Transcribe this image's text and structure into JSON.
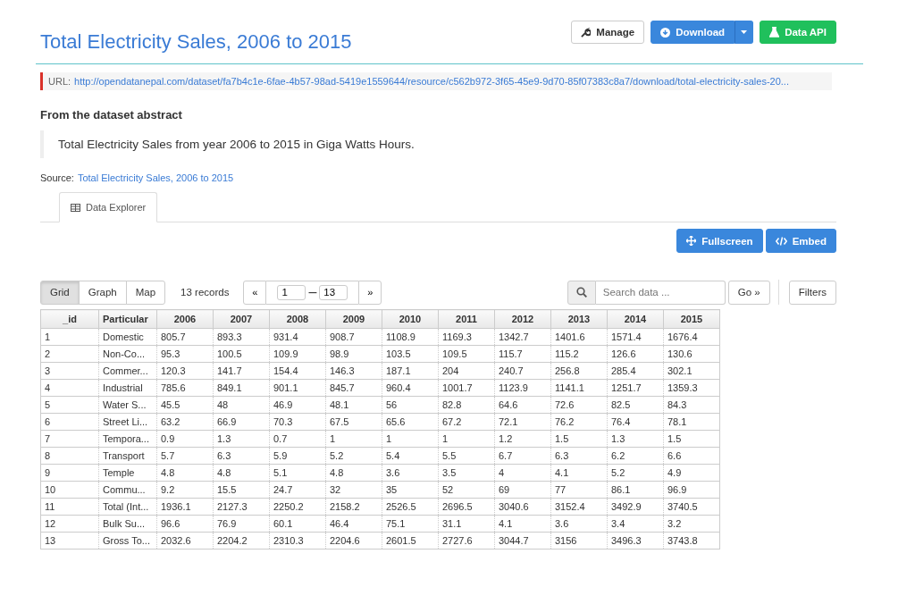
{
  "title": "Total Electricity Sales, 2006 to 2015",
  "actions": [
    {
      "kind": "manage",
      "label": "Manage"
    },
    {
      "kind": "download",
      "label": "Download"
    },
    {
      "kind": "api",
      "label": "Data API"
    }
  ],
  "url": {
    "label": "URL:",
    "link": "http://opendatanepal.com/dataset/fa7b4c1e-6fae-4b57-98ad-5419e1559644/resource/c562b972-3f65-45e9-9d70-85f07383c8a7/download/total-electricity-sales-20..."
  },
  "abstract": {
    "heading": "From the dataset abstract",
    "text": "Total Electricity Sales from year 2006 to 2015 in Giga Watts Hours."
  },
  "source": {
    "label": "Source:",
    "link": "Total Electricity Sales, 2006 to 2015"
  },
  "tabs": [
    {
      "label": "Data Explorer",
      "selected": true
    }
  ],
  "view_actions": [
    {
      "kind": "fullscreen",
      "label": "Fullscreen"
    },
    {
      "kind": "embed",
      "label": "Embed"
    }
  ],
  "views": [
    {
      "label": "Grid",
      "selected": true
    },
    {
      "label": "Graph",
      "selected": false
    },
    {
      "label": "Map",
      "selected": false
    }
  ],
  "records": "13 records",
  "pager": {
    "prev": "«",
    "from": "1",
    "dash": "–",
    "to": "13",
    "next": "»"
  },
  "search": {
    "placeholder": "Search data ...",
    "go": "Go »",
    "filters": "Filters"
  },
  "table": {
    "columns": [
      "_id",
      "Particular",
      "2006",
      "2007",
      "2008",
      "2009",
      "2010",
      "2011",
      "2012",
      "2013",
      "2014",
      "2015"
    ],
    "rows": [
      [
        "1",
        "Domestic",
        "805.7",
        "893.3",
        "931.4",
        "908.7",
        "1108.9",
        "1169.3",
        "1342.7",
        "1401.6",
        "1571.4",
        "1676.4"
      ],
      [
        "2",
        "Non-Co...",
        "95.3",
        "100.5",
        "109.9",
        "98.9",
        "103.5",
        "109.5",
        "115.7",
        "115.2",
        "126.6",
        "130.6"
      ],
      [
        "3",
        "Commer...",
        "120.3",
        "141.7",
        "154.4",
        "146.3",
        "187.1",
        "204",
        "240.7",
        "256.8",
        "285.4",
        "302.1"
      ],
      [
        "4",
        "Industrial",
        "785.6",
        "849.1",
        "901.1",
        "845.7",
        "960.4",
        "1001.7",
        "1123.9",
        "1141.1",
        "1251.7",
        "1359.3"
      ],
      [
        "5",
        "Water S...",
        "45.5",
        "48",
        "46.9",
        "48.1",
        "56",
        "82.8",
        "64.6",
        "72.6",
        "82.5",
        "84.3"
      ],
      [
        "6",
        "Street Li...",
        "63.2",
        "66.9",
        "70.3",
        "67.5",
        "65.6",
        "67.2",
        "72.1",
        "76.2",
        "76.4",
        "78.1"
      ],
      [
        "7",
        "Tempora...",
        "0.9",
        "1.3",
        "0.7",
        "1",
        "1",
        "1",
        "1.2",
        "1.5",
        "1.3",
        "1.5"
      ],
      [
        "8",
        "Transport",
        "5.7",
        "6.3",
        "5.9",
        "5.2",
        "5.4",
        "5.5",
        "6.7",
        "6.3",
        "6.2",
        "6.6"
      ],
      [
        "9",
        "Temple",
        "4.8",
        "4.8",
        "5.1",
        "4.8",
        "3.6",
        "3.5",
        "4",
        "4.1",
        "5.2",
        "4.9"
      ],
      [
        "10",
        "Commu...",
        "9.2",
        "15.5",
        "24.7",
        "32",
        "35",
        "52",
        "69",
        "77",
        "86.1",
        "96.9"
      ],
      [
        "11",
        "Total (Int...",
        "1936.1",
        "2127.3",
        "2250.2",
        "2158.2",
        "2526.5",
        "2696.5",
        "3040.6",
        "3152.4",
        "3492.9",
        "3740.5"
      ],
      [
        "12",
        "Bulk Su...",
        "96.6",
        "76.9",
        "60.1",
        "46.4",
        "75.1",
        "31.1",
        "4.1",
        "3.6",
        "3.4",
        "3.2"
      ],
      [
        "13",
        "Gross To...",
        "2032.6",
        "2204.2",
        "2310.3",
        "2204.6",
        "2601.5",
        "2727.6",
        "3044.7",
        "3156",
        "3496.3",
        "3743.8"
      ]
    ]
  }
}
